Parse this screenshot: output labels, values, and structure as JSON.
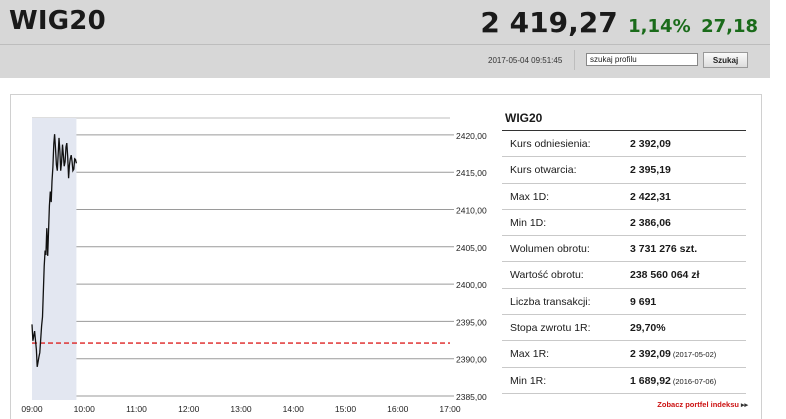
{
  "header": {
    "title": "WIG20",
    "price": "2 419,27",
    "change_pct": "1,14%",
    "change_abs": "27,18",
    "timestamp": "2017-05-04 09:51:45",
    "search_value": "szukaj profilu",
    "search_button": "Szukaj"
  },
  "colors": {
    "positive": "#1a6b1a",
    "reference_line": "#dd2222",
    "link": "#cc1111"
  },
  "chart_data": {
    "type": "line",
    "x_ticks": [
      "09:00",
      "10:00",
      "11:00",
      "12:00",
      "13:00",
      "14:00",
      "15:00",
      "16:00",
      "17:00"
    ],
    "y_ticks": [
      "2420,00",
      "2415,00",
      "2410,00",
      "2405,00",
      "2400,00",
      "2395,00",
      "2390,00",
      "2385,00"
    ],
    "ylim": [
      2385,
      2422
    ],
    "reference_value": 2392.09,
    "series": [
      {
        "x": [
          "09:00",
          "09:01",
          "09:03",
          "09:05",
          "09:06",
          "09:08",
          "09:09",
          "09:11",
          "09:12",
          "09:14",
          "09:15",
          "09:16",
          "09:17",
          "09:18",
          "09:20",
          "09:21",
          "09:22",
          "09:23",
          "09:24",
          "09:25",
          "09:26",
          "09:27",
          "09:28",
          "09:29",
          "09:30",
          "09:31",
          "09:32",
          "09:33",
          "09:34",
          "09:35",
          "09:36",
          "09:37",
          "09:38",
          "09:39",
          "09:40",
          "09:41",
          "09:42",
          "09:43",
          "09:44",
          "09:45",
          "09:46",
          "09:47",
          "09:48",
          "09:49",
          "09:50",
          "09:51"
        ],
        "y": [
          2394.6,
          2392.4,
          2393.7,
          2391.2,
          2388.9,
          2390.3,
          2390.8,
          2394.4,
          2395.6,
          2402.4,
          2404.5,
          2403.9,
          2407.5,
          2403.8,
          2410.5,
          2412.4,
          2411.0,
          2413.8,
          2415.7,
          2418.8,
          2420.1,
          2418.2,
          2416.0,
          2415.2,
          2417.2,
          2419.6,
          2417.8,
          2415.2,
          2416.4,
          2418.7,
          2417.4,
          2415.8,
          2416.4,
          2418.4,
          2418.9,
          2417.1,
          2414.2,
          2415.9,
          2416.8,
          2417.3,
          2416.4,
          2415.2,
          2415.4,
          2416.8,
          2416.7,
          2416.2
        ]
      }
    ],
    "grid": true
  },
  "info": {
    "title": "WIG20",
    "rows": [
      {
        "label": "Kurs odniesienia:",
        "value": "2 392,09",
        "date": ""
      },
      {
        "label": "Kurs otwarcia:",
        "value": "2 395,19",
        "date": ""
      },
      {
        "label": "Max 1D:",
        "value": "2 422,31",
        "date": ""
      },
      {
        "label": "Min 1D:",
        "value": "2 386,06",
        "date": ""
      },
      {
        "label": "Wolumen obrotu:",
        "value": "3 731 276 szt.",
        "date": ""
      },
      {
        "label": "Wartość obrotu:",
        "value": "238 560 064 zł",
        "date": ""
      },
      {
        "label": "Liczba transakcji:",
        "value": "9 691",
        "date": ""
      },
      {
        "label": "Stopa zwrotu 1R:",
        "value": "29,70%",
        "date": ""
      },
      {
        "label": "Max 1R:",
        "value": "2 392,09",
        "date": "(2017-05-02)"
      },
      {
        "label": "Min 1R:",
        "value": "1 689,92",
        "date": "(2016-07-06)"
      }
    ],
    "link": "Zobacz portfel indeksu"
  }
}
